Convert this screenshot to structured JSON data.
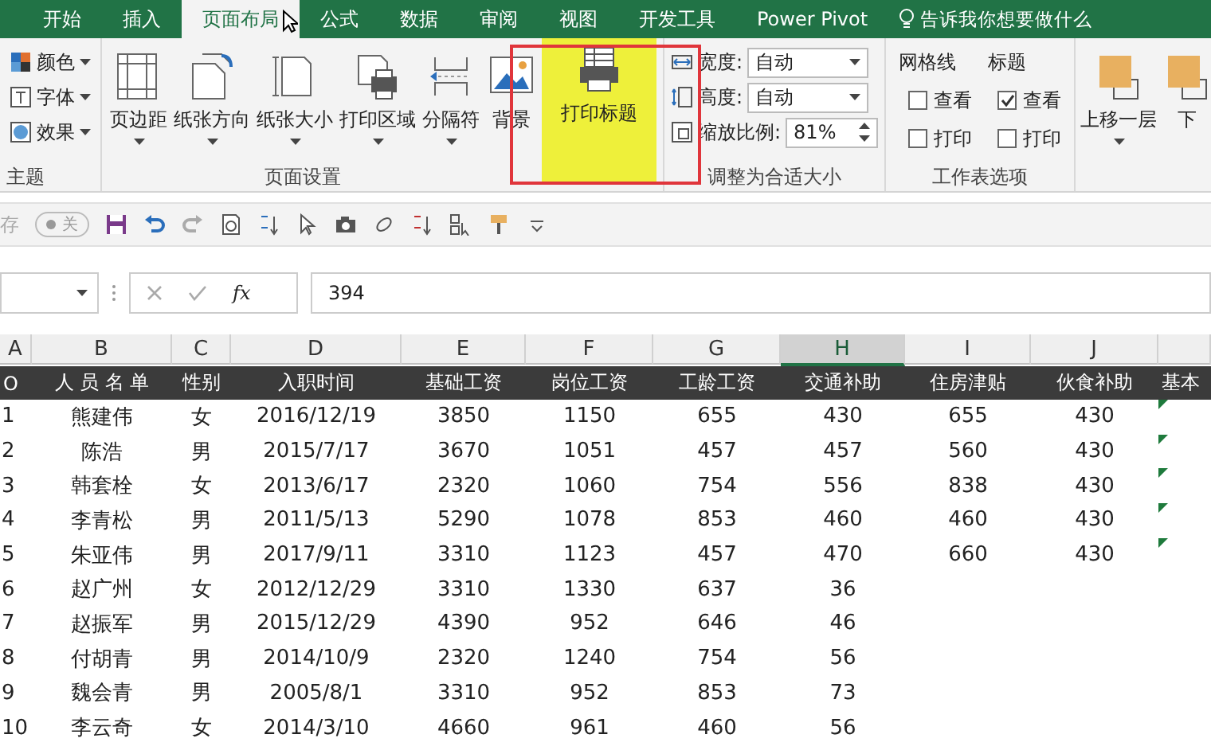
{
  "tabs": [
    {
      "label": "开始",
      "selected": false
    },
    {
      "label": "插入",
      "selected": false
    },
    {
      "label": "页面布局",
      "selected": true
    },
    {
      "label": "公式",
      "selected": false
    },
    {
      "label": "数据",
      "selected": false
    },
    {
      "label": "审阅",
      "selected": false
    },
    {
      "label": "视图",
      "selected": false
    },
    {
      "label": "开发工具",
      "selected": false
    },
    {
      "label": "Power Pivot",
      "selected": false
    }
  ],
  "tell_me": {
    "placeholder": "告诉我你想要做什么"
  },
  "ribbon": {
    "themes": {
      "label": "主题",
      "items": [
        "颜色",
        "字体",
        "效果"
      ]
    },
    "page_setup": {
      "label": "页面设置",
      "buttons": [
        {
          "label": "页边距",
          "kind": "margins",
          "dropdown": true,
          "highlighted": false
        },
        {
          "label": "纸张方向",
          "kind": "orientation",
          "dropdown": true,
          "highlighted": false
        },
        {
          "label": "纸张大小",
          "kind": "size",
          "dropdown": true,
          "highlighted": false
        },
        {
          "label": "打印区域",
          "kind": "printarea",
          "dropdown": true,
          "highlighted": false
        },
        {
          "label": "分隔符",
          "kind": "breaks",
          "dropdown": true,
          "highlighted": false
        },
        {
          "label": "背景",
          "kind": "background",
          "dropdown": false,
          "highlighted": false
        },
        {
          "label": "打印标题",
          "kind": "titles",
          "dropdown": false,
          "highlighted": true
        }
      ]
    },
    "scale_to_fit": {
      "label": "调整为合适大小",
      "fields": [
        {
          "label": "宽度:",
          "value": "自动",
          "kind": "dropdown"
        },
        {
          "label": "高度:",
          "value": "自动",
          "kind": "dropdown"
        },
        {
          "label": "缩放比例:",
          "value": "81%",
          "kind": "spinner"
        }
      ]
    },
    "sheet_options": {
      "label": "工作表选项",
      "columns": [
        {
          "title": "网格线",
          "options": [
            {
              "label": "查看",
              "checked": false
            },
            {
              "label": "打印",
              "checked": false
            }
          ]
        },
        {
          "title": "标题",
          "options": [
            {
              "label": "查看",
              "checked": true
            },
            {
              "label": "打印",
              "checked": false
            }
          ]
        }
      ]
    },
    "arrange": {
      "buttons": [
        "上移一层",
        "下"
      ]
    }
  },
  "quick_access": {
    "autosave_label": "存",
    "autosave_toggle": "关",
    "autosave_on": false
  },
  "formula_bar": {
    "function_label": "fx",
    "value": "394"
  },
  "sheet": {
    "columns": [
      {
        "letter": "A",
        "selected": false
      },
      {
        "letter": "B",
        "selected": false
      },
      {
        "letter": "C",
        "selected": false
      },
      {
        "letter": "D",
        "selected": false
      },
      {
        "letter": "E",
        "selected": false
      },
      {
        "letter": "F",
        "selected": false
      },
      {
        "letter": "G",
        "selected": false
      },
      {
        "letter": "H",
        "selected": true
      },
      {
        "letter": "I",
        "selected": false
      },
      {
        "letter": "J",
        "selected": false
      }
    ],
    "header": [
      "O",
      "人 员 名 单",
      "性别",
      "入职时间",
      "基础工资",
      "岗位工资",
      "工龄工资",
      "交通补助",
      "住房津贴",
      "伙食补助",
      "基本"
    ],
    "rows": [
      {
        "cells": [
          "1",
          "熊建伟",
          "女",
          "2016/12/19",
          "3850",
          "1150",
          "655",
          "430",
          "655",
          "430"
        ],
        "warning": true
      },
      {
        "cells": [
          "2",
          "陈浩",
          "男",
          "2015/7/17",
          "3670",
          "1051",
          "457",
          "457",
          "560",
          "430"
        ],
        "warning": true
      },
      {
        "cells": [
          "3",
          "韩套栓",
          "女",
          "2013/6/17",
          "2320",
          "1060",
          "754",
          "556",
          "838",
          "430"
        ],
        "warning": true
      },
      {
        "cells": [
          "4",
          "李青松",
          "男",
          "2011/5/13",
          "5290",
          "1078",
          "853",
          "460",
          "460",
          "430"
        ],
        "warning": true
      },
      {
        "cells": [
          "5",
          "朱亚伟",
          "男",
          "2017/9/11",
          "3310",
          "1123",
          "457",
          "470",
          "660",
          "430"
        ],
        "warning": true
      },
      {
        "cells": [
          "6",
          "赵广州",
          "女",
          "2012/12/29",
          "3310",
          "1330",
          "637",
          "36"
        ],
        "warning": false
      },
      {
        "cells": [
          "7",
          "赵振军",
          "男",
          "2015/12/29",
          "4390",
          "952",
          "646",
          "46"
        ],
        "warning": false
      },
      {
        "cells": [
          "8",
          "付胡青",
          "男",
          "2014/10/9",
          "2320",
          "1240",
          "754",
          "56"
        ],
        "warning": false
      },
      {
        "cells": [
          "9",
          "魏会青",
          "男",
          "2005/8/1",
          "3310",
          "952",
          "853",
          "73"
        ],
        "warning": false
      },
      {
        "cells": [
          "10",
          "李云奇",
          "女",
          "2014/3/10",
          "4660",
          "961",
          "460",
          "56"
        ],
        "warning": false
      }
    ]
  }
}
